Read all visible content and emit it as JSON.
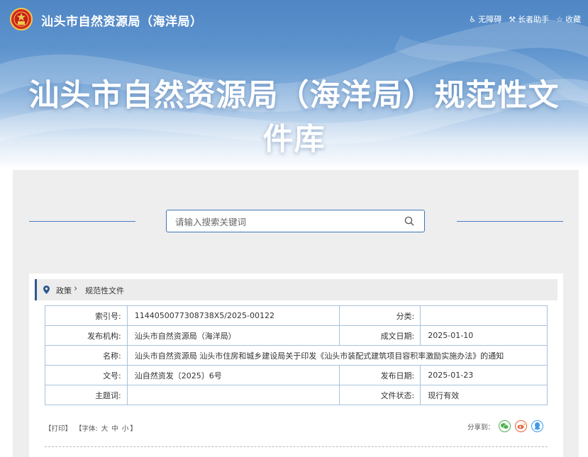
{
  "header": {
    "site_title": "汕头市自然资源局（海洋局）",
    "tools": [
      {
        "icon": "accessibility-icon",
        "label": "无障碍"
      },
      {
        "icon": "elder-assist-icon",
        "label": "长者助手"
      },
      {
        "icon": "star-icon",
        "label": "收藏"
      }
    ],
    "banner_title": "汕头市自然资源局（海洋局）规范性文件库"
  },
  "search": {
    "placeholder": "请输入搜索关键词",
    "value": ""
  },
  "breadcrumb": {
    "items": [
      "政策",
      "规范性文件"
    ]
  },
  "doc_info": {
    "rows": [
      {
        "l1": "索引号:",
        "v1": "114405007730873 8X5/2025-00122",
        "l2": "分类:",
        "v2": ""
      },
      {
        "l1": "发布机构:",
        "v1": "汕头市自然资源局（海洋局）",
        "l2": "成文日期:",
        "v2": "2025-01-10"
      },
      {
        "l1": "名称:",
        "v1": "汕头市自然资源局 汕头市住房和城乡建设局关于印发《汕头市装配式建筑项目容积率激励实施办法》的通知"
      },
      {
        "l1": "文号:",
        "v1": "汕自然资发〔2025〕6号",
        "l2": "发布日期:",
        "v2": "2025-01-23"
      },
      {
        "l1": "主题词:",
        "v1": "",
        "l2": "文件状态:",
        "v2": "现行有效"
      }
    ]
  },
  "actions": {
    "print": "【打印】",
    "font_prefix": "【字体:",
    "font_large": "大",
    "font_medium": "中",
    "font_small": "小",
    "font_suffix": "】"
  },
  "share": {
    "label": "分享到：",
    "colors": {
      "wechat": "#4cae4c",
      "weibo": "#e8613c",
      "qq": "#3d9be9"
    }
  },
  "colors": {
    "accent": "#3d78b8",
    "header_blue": "#4f86c4"
  }
}
